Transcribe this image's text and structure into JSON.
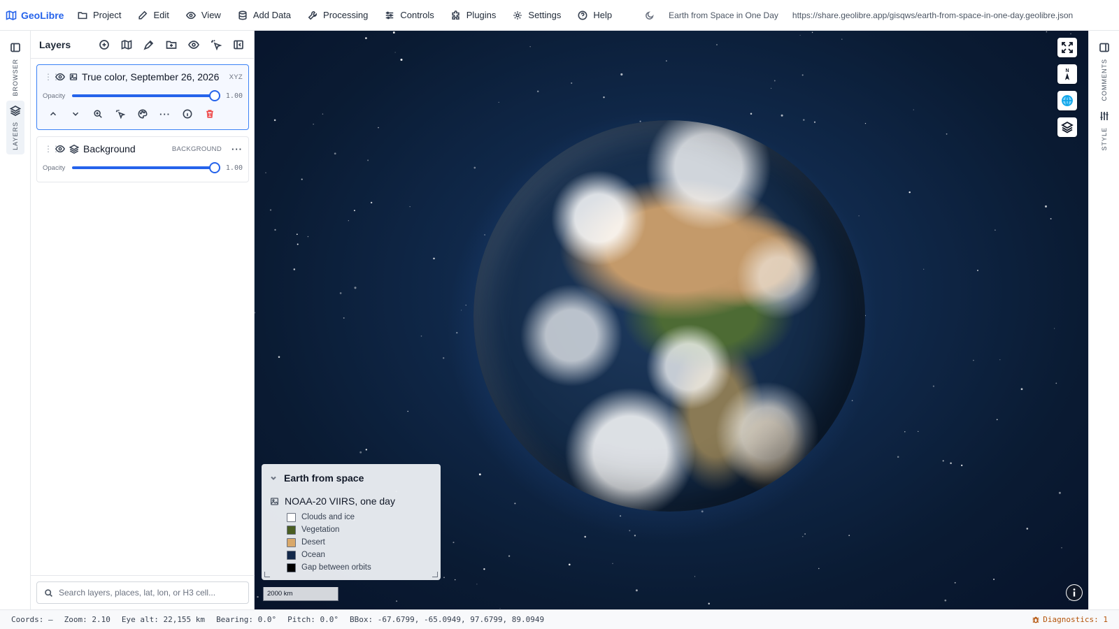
{
  "app": {
    "brand": "GeoLibre"
  },
  "menu": [
    {
      "label": "Project",
      "icon": "folder-icon"
    },
    {
      "label": "Edit",
      "icon": "pencil-icon"
    },
    {
      "label": "View",
      "icon": "eye-icon"
    },
    {
      "label": "Add Data",
      "icon": "database-icon"
    },
    {
      "label": "Processing",
      "icon": "wrench-icon"
    },
    {
      "label": "Controls",
      "icon": "sliders-icon"
    },
    {
      "label": "Plugins",
      "icon": "puzzle-icon"
    },
    {
      "label": "Settings",
      "icon": "gear-icon"
    },
    {
      "label": "Help",
      "icon": "help-circle-icon"
    }
  ],
  "header": {
    "project_title": "Earth from Space in One Day",
    "share_url": "https://share.geolibre.app/gisqws/earth-from-space-in-one-day.geolibre.json"
  },
  "left_rail": {
    "browser": "BROWSER",
    "layers": "LAYERS"
  },
  "right_rail": {
    "comments": "COMMENTS",
    "style": "STYLE"
  },
  "layers_panel": {
    "title": "Layers",
    "search_placeholder": "Search layers, places, lat, lon, or H3 cell...",
    "layers": [
      {
        "name": "True color, September 26, 2026",
        "type": "XYZ",
        "opacity_label": "Opacity",
        "opacity": 1.0,
        "opacity_text": "1.00",
        "selected": true
      },
      {
        "name": "Background",
        "type": "BACKGROUND",
        "opacity_label": "Opacity",
        "opacity": 1.0,
        "opacity_text": "1.00",
        "selected": false
      }
    ]
  },
  "legend": {
    "title": "Earth from space",
    "layer_name": "NOAA-20 VIIRS, one day",
    "items": [
      {
        "label": "Clouds and ice",
        "color": "#ffffff"
      },
      {
        "label": "Vegetation",
        "color": "#4a5e23"
      },
      {
        "label": "Desert",
        "color": "#d9a86a"
      },
      {
        "label": "Ocean",
        "color": "#13284a"
      },
      {
        "label": "Gap between orbits",
        "color": "#000000"
      }
    ]
  },
  "map": {
    "scale_label": "2000 km",
    "compass": "N"
  },
  "statusbar": {
    "coords": "Coords: —",
    "zoom": "Zoom: 2.10",
    "eye_alt": "Eye alt: 22,155 km",
    "bearing": "Bearing: 0.0°",
    "pitch": "Pitch: 0.0°",
    "bbox": "BBox: -67.6799, -65.0949, 97.6799, 89.0949",
    "diagnostics": "Diagnostics: 1"
  },
  "colors": {
    "accent": "#2563eb",
    "danger": "#ef4444",
    "warning": "#b45309"
  }
}
